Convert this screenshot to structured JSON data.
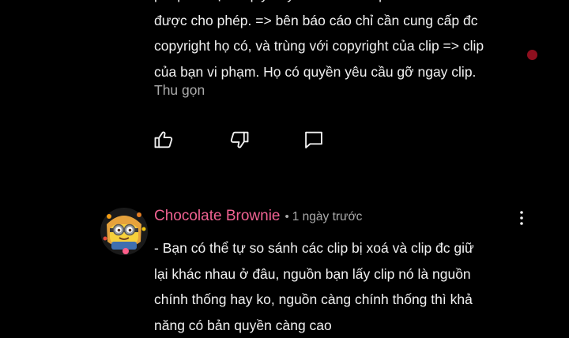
{
  "comments": [
    {
      "lines": [
        "phép. ... họ có quyền yêu cầu xoá clip",
        "được cho phép. => bên báo cáo chỉ cần cung cấp đc",
        "copyright họ có, và trùng với copyright của clip => clip",
        "của bạn vi phạm. Họ có quyền yêu cầu gỡ ngay clip."
      ],
      "collapse_label": "Thu gọn",
      "actions": {
        "like_icon": "thumbs-up-icon",
        "dislike_icon": "thumbs-down-icon",
        "reply_icon": "comment-icon"
      }
    },
    {
      "author": "Chocolate Brownie",
      "separator": "•",
      "timestamp": "1 ngày trước",
      "more_icon": "more-vertical-icon",
      "avatar": "minion-avatar",
      "lines": [
        "- Bạn có thể tự so sánh các clip bị xoá và clip đc giữ",
        "lại khác nhau ở đâu, nguồn bạn lấy clip nó là nguồn",
        "chính thống hay ko, nguồn càng chính thống thì khả",
        "năng có bản quyền càng cao"
      ]
    }
  ],
  "colors": {
    "background": "#000000",
    "text": "#f1f1f1",
    "secondary": "#aaaaaa",
    "author": "#f06292",
    "indicator": "#8e0f1e"
  }
}
